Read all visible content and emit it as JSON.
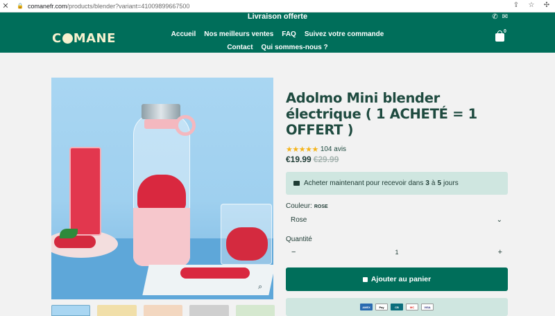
{
  "browser": {
    "close_icon": "close-icon",
    "url_host": "comanefr.com",
    "url_path": "/products/blender?variant=41009899667500"
  },
  "header": {
    "announcement": "Livraison offerte",
    "logo": "COMANE",
    "nav": [
      "Accueil",
      "Nos meilleurs ventes",
      "FAQ",
      "Suivez votre commande",
      "Contact",
      "Qui sommes-nous ?"
    ],
    "cart_count": "0",
    "colors": {
      "brand": "#006e5a",
      "logo": "#f7f1cf"
    }
  },
  "product": {
    "title": "Adolmo Mini blender électrique ( 1 ACHETÉ = 1 OFFERT )",
    "stars": "★★★★★",
    "reviews": "104 avis",
    "price": "€19.99",
    "compare_price": "€29.99",
    "shipping": {
      "pre": "Acheter maintenant pour recevoir dans",
      "from": "3",
      "mid": "à",
      "to": "5",
      "post": "jours"
    },
    "color_label": "Couleur:",
    "color_value": "ROSE",
    "color_selected": "Rose",
    "qty_label": "Quantité",
    "qty_minus": "−",
    "qty_value": "1",
    "qty_plus": "+",
    "add_to_cart": "Ajouter au panier",
    "payment_methods": [
      "AMEX",
      "Pay",
      "CB",
      "MC",
      "VISA"
    ]
  }
}
